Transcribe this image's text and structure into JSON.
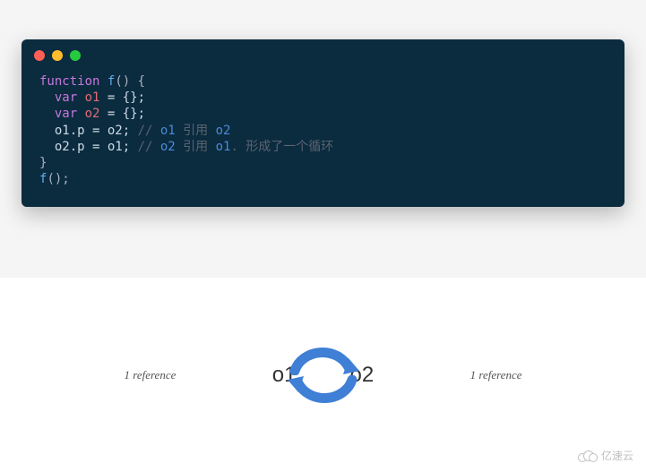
{
  "code": {
    "lines": [
      {
        "segments": [
          {
            "cls": "kw",
            "t": "function"
          },
          {
            "cls": "plain",
            "t": " "
          },
          {
            "cls": "fn",
            "t": "f"
          },
          {
            "cls": "punct",
            "t": "() {"
          }
        ]
      },
      {
        "segments": [
          {
            "cls": "plain",
            "t": "  "
          },
          {
            "cls": "kw",
            "t": "var"
          },
          {
            "cls": "plain",
            "t": " "
          },
          {
            "cls": "var",
            "t": "o1"
          },
          {
            "cls": "plain",
            "t": " = {};"
          }
        ]
      },
      {
        "segments": [
          {
            "cls": "plain",
            "t": "  "
          },
          {
            "cls": "kw",
            "t": "var"
          },
          {
            "cls": "plain",
            "t": " "
          },
          {
            "cls": "var",
            "t": "o2"
          },
          {
            "cls": "plain",
            "t": " = {};"
          }
        ]
      },
      {
        "segments": [
          {
            "cls": "plain",
            "t": "  o1.p = o2; "
          },
          {
            "cls": "comment",
            "t": "// "
          },
          {
            "cls": "comment-hl",
            "t": "o1"
          },
          {
            "cls": "comment",
            "t": " 引用 "
          },
          {
            "cls": "comment-hl",
            "t": "o2"
          }
        ]
      },
      {
        "segments": [
          {
            "cls": "plain",
            "t": "  o2.p = o1; "
          },
          {
            "cls": "comment",
            "t": "// "
          },
          {
            "cls": "comment-hl",
            "t": "o2"
          },
          {
            "cls": "comment",
            "t": " 引用 "
          },
          {
            "cls": "comment-hl",
            "t": "o1"
          },
          {
            "cls": "comment",
            "t": ". 形成了一个循环"
          }
        ]
      },
      {
        "segments": [
          {
            "cls": "punct",
            "t": "}"
          }
        ]
      },
      {
        "segments": [
          {
            "cls": "plain",
            "t": ""
          }
        ]
      },
      {
        "segments": [
          {
            "cls": "fn",
            "t": "f"
          },
          {
            "cls": "punct",
            "t": "();"
          }
        ]
      }
    ]
  },
  "diagram": {
    "left_ref": "1 reference",
    "right_ref": "1 reference",
    "node_o1": "o1",
    "node_o2": "o2",
    "arrow_color": "#3f7fd6"
  },
  "watermark": {
    "text": "亿速云"
  }
}
